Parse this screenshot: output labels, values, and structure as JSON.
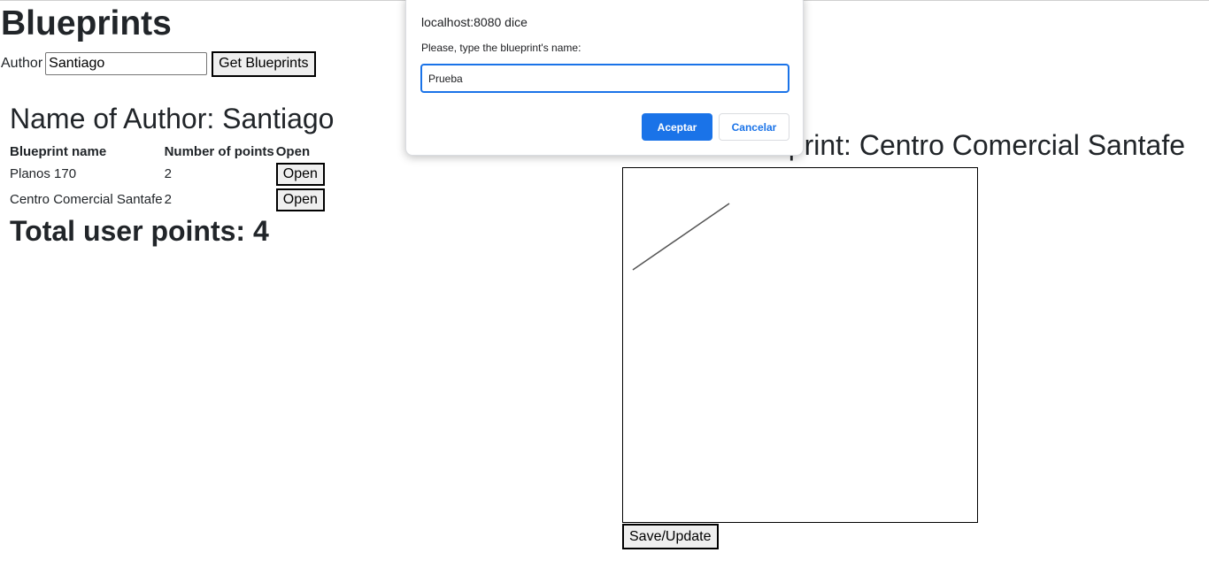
{
  "page": {
    "title": "Blueprints"
  },
  "author_form": {
    "label": "Author",
    "value": "Santiago",
    "button_label": "Get Blueprints"
  },
  "author_section": {
    "heading": "Name of Author: Santiago",
    "columns": [
      "Blueprint name",
      "Number of points",
      "Open"
    ],
    "rows": [
      {
        "name": "Planos 170",
        "points": "2",
        "action": "Open"
      },
      {
        "name": "Centro Comercial Santafe",
        "points": "2",
        "action": "Open"
      }
    ],
    "total": "Total user points: 4"
  },
  "current_blueprint": {
    "heading": "Current blueprint: Centro Comercial Santafe",
    "save_label": "Save/Update",
    "line_color": "#555555"
  },
  "dialog": {
    "origin": "localhost:8080 dice",
    "message": "Please, type the blueprint's name:",
    "input_value": "Prueba",
    "ok_label": "Aceptar",
    "cancel_label": "Cancelar",
    "accent_color": "#1a73e8"
  }
}
